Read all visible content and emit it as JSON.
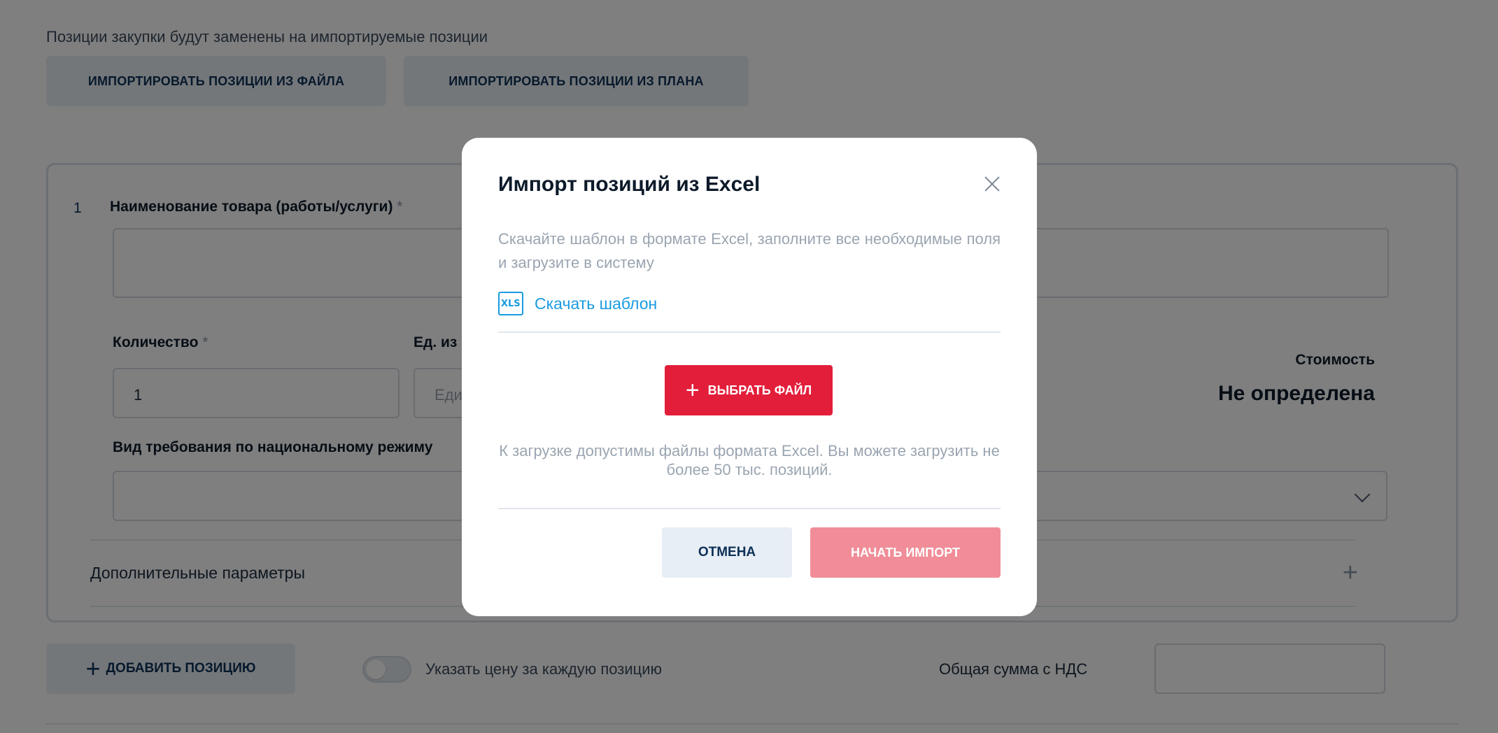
{
  "background": {
    "notice": "Позиции закупки будут заменены на импортируемые позиции",
    "import_file_label": "ИМПОРТИРОВАТЬ ПОЗИЦИИ ИЗ ФАЙЛА",
    "import_plan_label": "ИМПОРТИРОВАТЬ ПОЗИЦИИ ИЗ ПЛАНА",
    "position": {
      "number": "1",
      "name_label": "Наименование товара (работы/услуги)",
      "required_mark": "*",
      "quantity_label": "Количество",
      "quantity_value": "1",
      "unit_label": "Ед. из",
      "unit_placeholder": "Еди",
      "national_regime_label": "Вид требования по национальному режиму",
      "cost_label": "Стоимость",
      "cost_value": "Не определена",
      "extra_params_label": "Дополнительные параметры"
    },
    "add_position_label": "ДОБАВИТЬ ПОЗИЦИЮ",
    "toggle_label": "Указать цену за каждую позицию",
    "total_label": "Общая сумма с НДС"
  },
  "modal": {
    "title": "Импорт позиций из Excel",
    "description": "Скачайте шаблон в формате Excel, заполните все необходимые поля и загрузите в систему",
    "download_icon_text": "XLS",
    "download_label": "Скачать шаблон",
    "choose_file_label": "ВЫБРАТЬ ФАЙЛ",
    "hint": "К загрузке допустимы файлы формата Excel. Вы можете загрузить не более 50 тыс. позиций.",
    "cancel_label": "ОТМЕНА",
    "start_label": "НАЧАТЬ ИМПОРТ"
  },
  "colors": {
    "accent_red": "#e31e3a",
    "disabled_red": "#f08d98",
    "link_blue": "#1a9be0",
    "secondary_button": "#e8eef5"
  }
}
